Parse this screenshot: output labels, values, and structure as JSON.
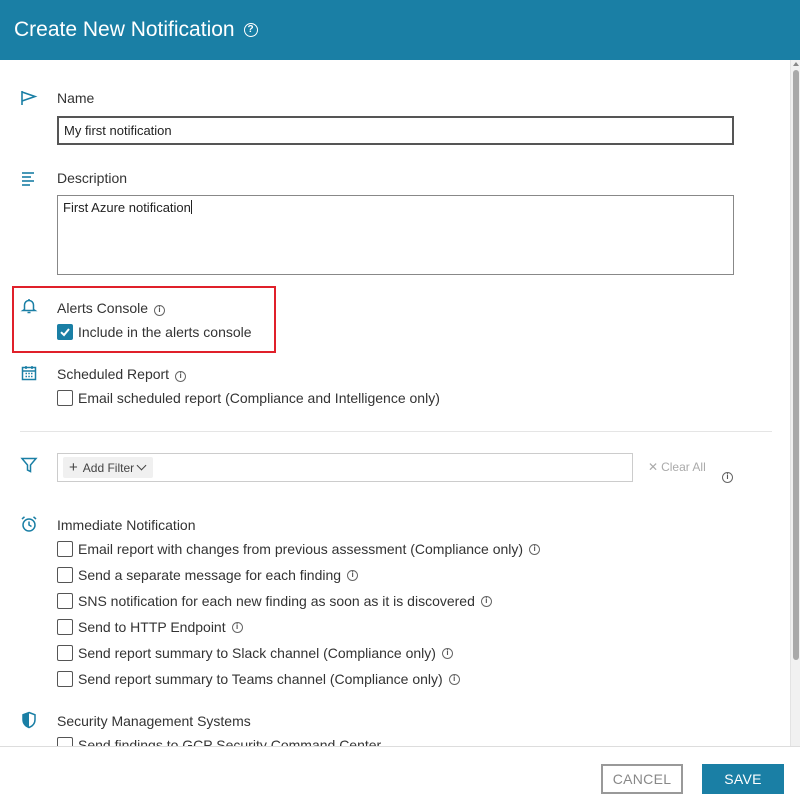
{
  "dialog": {
    "title": "Create New Notification"
  },
  "name": {
    "label": "Name",
    "value": "My first notification"
  },
  "description": {
    "label": "Description",
    "value": "First Azure notification"
  },
  "alerts_console": {
    "label": "Alerts Console",
    "checkbox_label": "Include in the alerts console",
    "checked": true
  },
  "scheduled_report": {
    "label": "Scheduled Report",
    "checkbox_label": "Email scheduled report (Compliance and Intelligence only)",
    "checked": false
  },
  "filter": {
    "add_filter_label": "Add Filter",
    "clear_all_label": "Clear All"
  },
  "immediate_notification": {
    "label": "Immediate Notification",
    "options": [
      {
        "label": "Email report with changes from previous assessment (Compliance only)",
        "checked": false
      },
      {
        "label": "Send a separate message for each finding",
        "checked": false
      },
      {
        "label": "SNS notification for each new finding as soon as it is discovered",
        "checked": false
      },
      {
        "label": "Send to HTTP Endpoint",
        "checked": false
      },
      {
        "label": "Send report summary to Slack channel (Compliance only)",
        "checked": false
      },
      {
        "label": "Send report summary to Teams channel (Compliance only)",
        "checked": false
      }
    ]
  },
  "security_management": {
    "label": "Security Management Systems",
    "options": [
      {
        "label": "Send findings to GCP Security Command Center",
        "checked": false
      }
    ]
  },
  "footer": {
    "cancel_label": "CANCEL",
    "save_label": "SAVE"
  },
  "colors": {
    "header": "#1a7fa5",
    "accent": "#1a7fa5",
    "highlight": "#e0202a"
  },
  "icons": {
    "help": "help-circle-icon",
    "name": "flag-icon",
    "description": "align-left-icon",
    "alerts": "bell-icon",
    "scheduled": "calendar-icon",
    "filter": "filter-icon",
    "immediate": "alarm-clock-icon",
    "security": "shield-icon"
  }
}
